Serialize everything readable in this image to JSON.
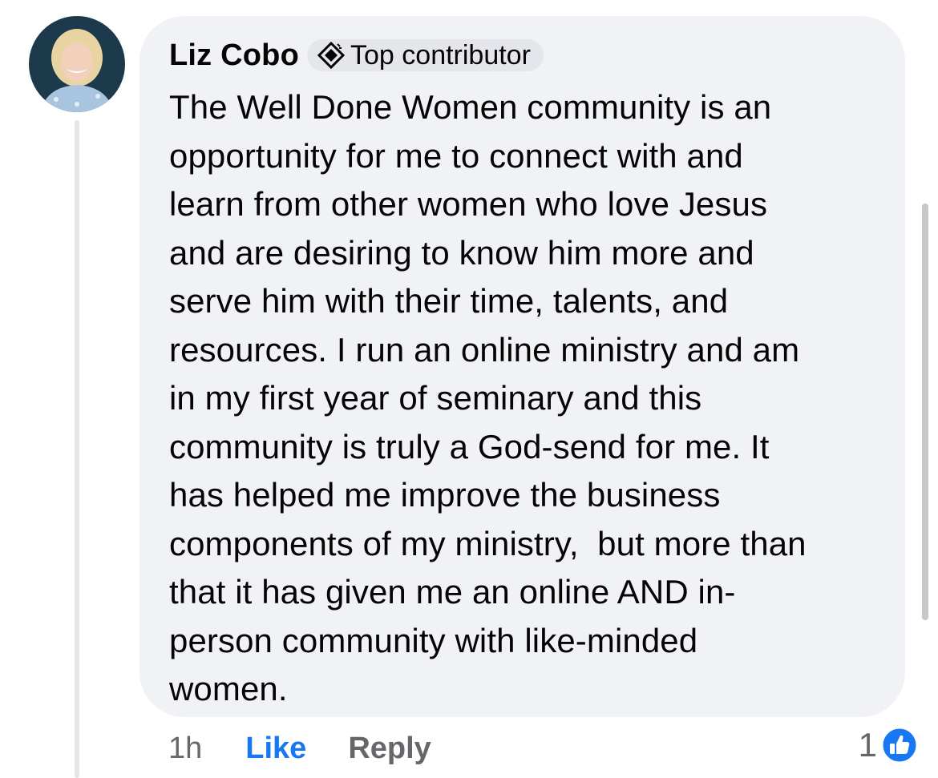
{
  "comment": {
    "author": "Liz Cobo",
    "badge_label": "Top contributor",
    "badge_icon": "top-contributor-diamond-icon",
    "text": "The Well Done Women community is an\nopportunity for me to connect with and\nlearn from other women who love Jesus\nand are desiring to know him more and\nserve him with their time, talents, and\nresources. I run an online ministry and am\nin my first year of seminary and this\ncommunity is truly a God-send for me. It\nhas helped me improve the business\ncomponents of my ministry,  but more than\nthat it has given me an online AND in-\nperson community with like-minded\nwomen.",
    "timestamp": "1h",
    "like_label": "Like",
    "reply_label": "Reply",
    "reaction_count": "1",
    "reaction_icon": "like-thumbs-up-icon"
  },
  "colors": {
    "bubble_bg": "#f0f2f5",
    "badge_bg": "#e4e6eb",
    "link_blue": "#1877f2",
    "muted_gray": "#65676b",
    "text_dark": "#050505"
  }
}
